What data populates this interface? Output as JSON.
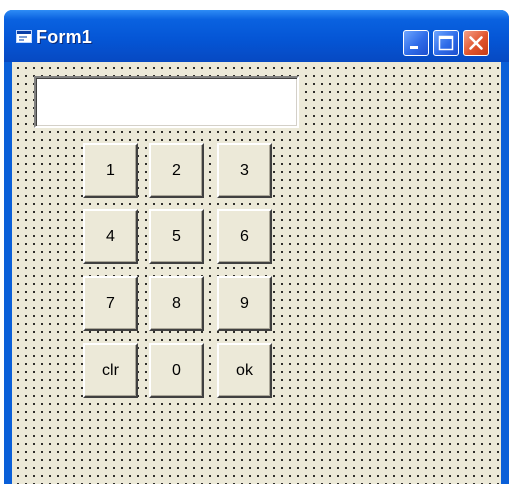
{
  "window": {
    "title": "Form1",
    "title_icon": "form-icon",
    "controls": {
      "minimize_icon": "minimize-icon",
      "maximize_icon": "maximize-icon",
      "close_icon": "close-icon"
    }
  },
  "form": {
    "textbox_value": "",
    "keys": [
      {
        "label": "1"
      },
      {
        "label": "2"
      },
      {
        "label": "3"
      },
      {
        "label": "4"
      },
      {
        "label": "5"
      },
      {
        "label": "6"
      },
      {
        "label": "7"
      },
      {
        "label": "8"
      },
      {
        "label": "9"
      },
      {
        "label": "clr"
      },
      {
        "label": "0"
      },
      {
        "label": "ok"
      }
    ]
  },
  "colors": {
    "titlebar": "#0556d6",
    "client_background": "#ece9d8",
    "close_button": "#e0542c"
  }
}
